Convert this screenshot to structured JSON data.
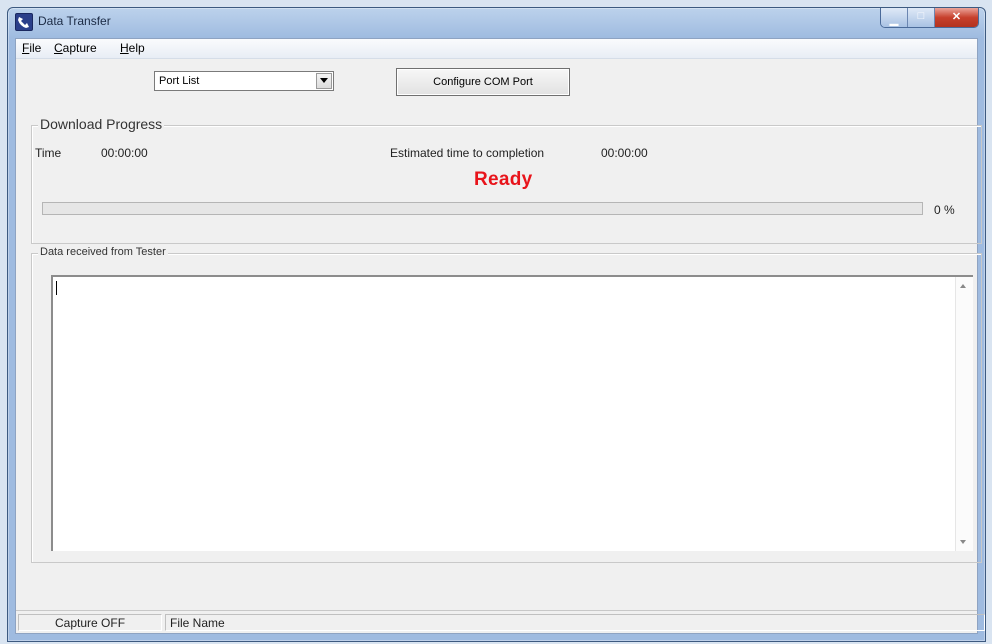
{
  "window": {
    "title": "Data Transfer",
    "icon": "phone-icon"
  },
  "menu": {
    "file": "File",
    "capture": "Capture",
    "help": "Help"
  },
  "port_select": {
    "value": "Port List"
  },
  "configure_button": {
    "label": "Configure COM Port"
  },
  "download": {
    "group_label": "Download Progress",
    "time_label": "Time",
    "time_value": "00:00:00",
    "eta_label": "Estimated time to completion",
    "eta_value": "00:00:00",
    "status": "Ready",
    "status_color": "#e8141b",
    "progress_percent": 0,
    "progress_text": "0 %"
  },
  "data_received": {
    "group_label": "Data received from Tester",
    "content": ""
  },
  "statusbar": {
    "capture": "Capture OFF",
    "file_name": "File Name"
  }
}
